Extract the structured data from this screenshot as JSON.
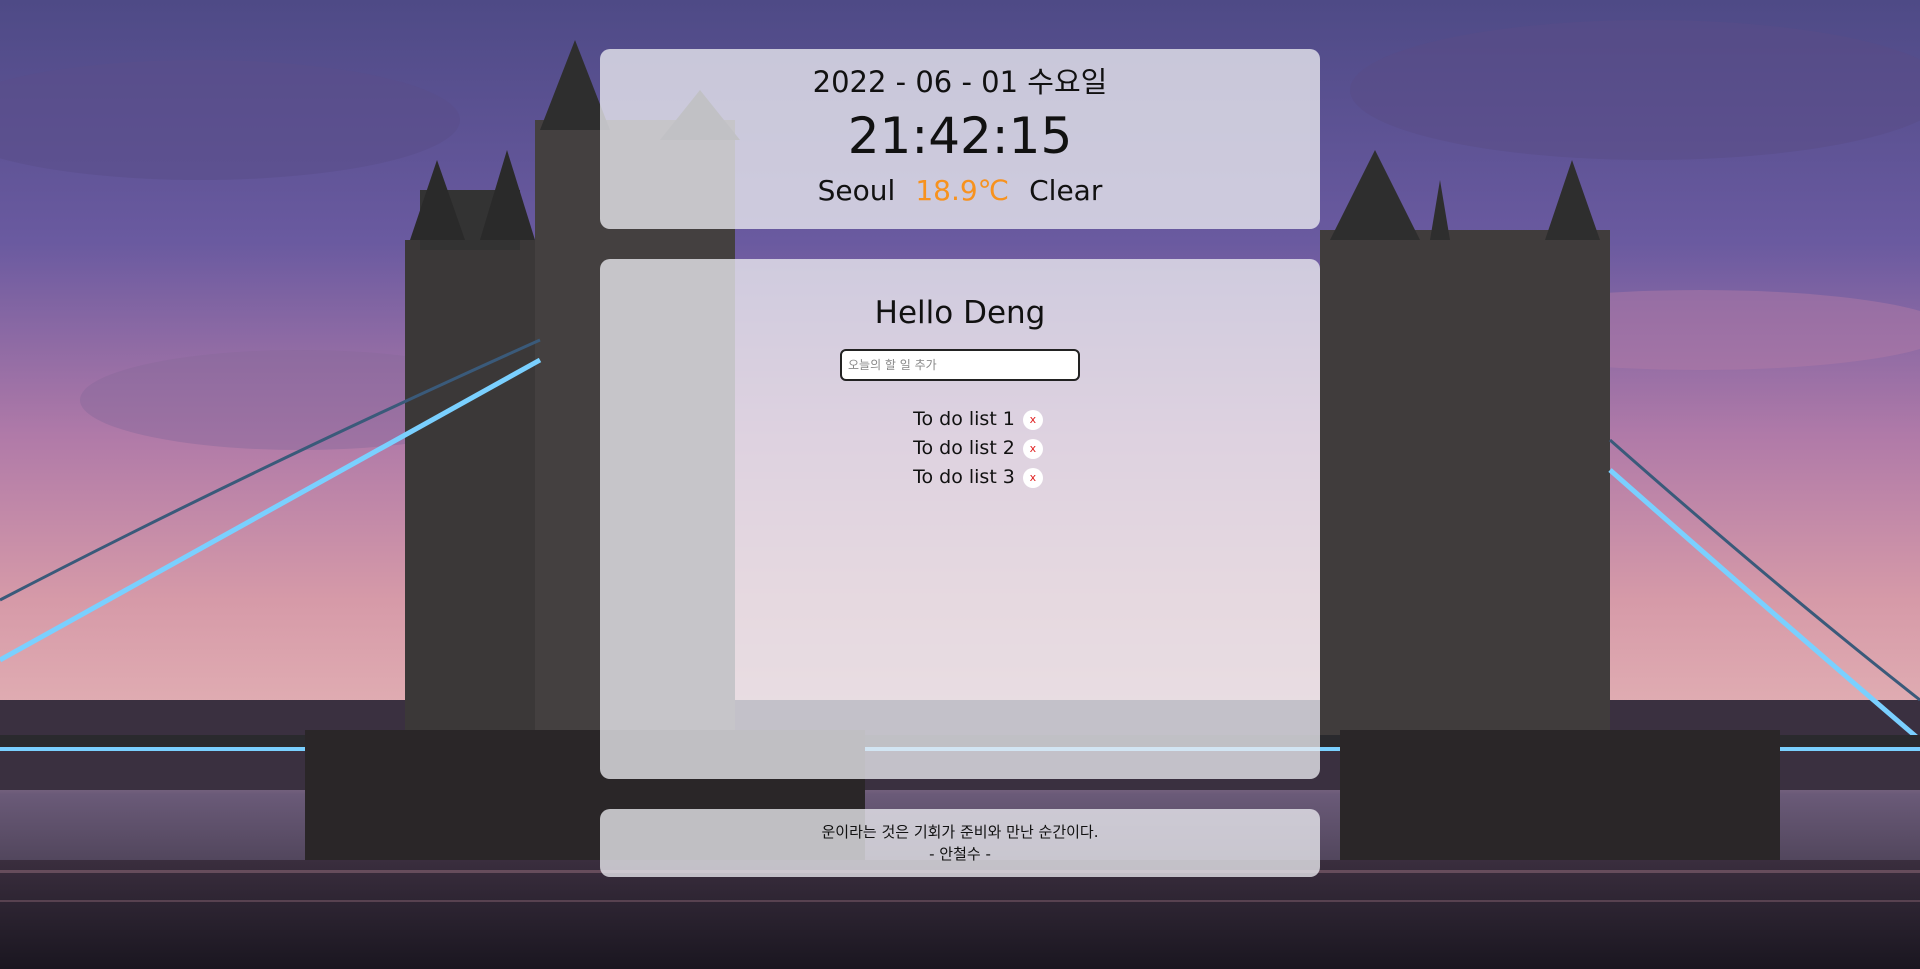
{
  "clock": {
    "date": "2022 - 06 - 01 수요일",
    "time": "21:42:15"
  },
  "weather": {
    "city": "Seoul",
    "temperature": "18.9℃",
    "condition": "Clear",
    "temp_color": "#f7921e"
  },
  "greeting": "Hello Deng",
  "todo": {
    "input_placeholder": "오늘의 할 일 추가",
    "input_value": "",
    "delete_label": "x",
    "items": [
      {
        "text": "To do list 1"
      },
      {
        "text": "To do list 2"
      },
      {
        "text": "To do list 3"
      }
    ]
  },
  "quote": {
    "text": "운이라는 것은 기회가 준비와 만난 순간이다.",
    "author": "- 안철수 -"
  }
}
